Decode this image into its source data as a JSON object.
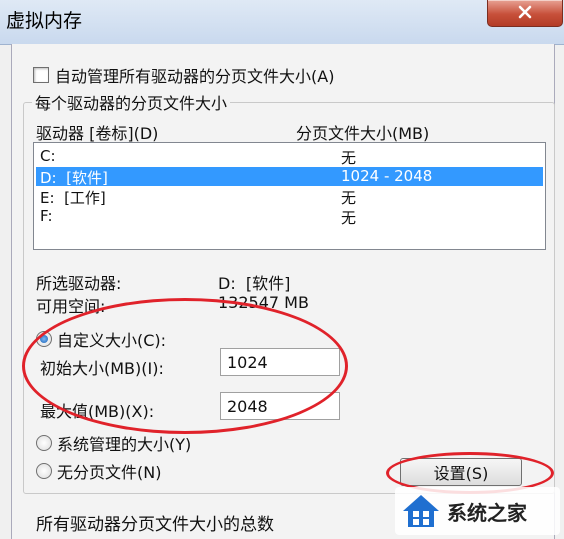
{
  "window": {
    "title": "虚拟内存"
  },
  "auto_manage": {
    "label": "自动管理所有驱动器的分页文件大小(A)",
    "checked": false
  },
  "group": {
    "legend": "每个驱动器的分页文件大小",
    "col_drive": "驱动器 [卷标](D)",
    "col_size": "分页文件大小(MB)"
  },
  "drives": [
    {
      "drive": "C:",
      "size": "无",
      "selected": false
    },
    {
      "drive": "D:  [软件]",
      "size": "1024 - 2048",
      "selected": true
    },
    {
      "drive": "E:  [工作]",
      "size": "无",
      "selected": false
    },
    {
      "drive": "F:",
      "size": "无",
      "selected": false
    }
  ],
  "selected_drive": {
    "label": "所选驱动器:",
    "value": "D:  [软件]"
  },
  "free_space": {
    "label": "可用空间:",
    "value": "132547 MB"
  },
  "custom_size": {
    "label": "自定义大小(C):",
    "checked": true
  },
  "initial_size": {
    "label": "初始大小(MB)(I):",
    "value": "1024"
  },
  "max_size": {
    "label": "最大值(MB)(X):",
    "value": "2048"
  },
  "system_managed": {
    "label": "系统管理的大小(Y)",
    "checked": false
  },
  "no_paging": {
    "label": "无分页文件(N)",
    "checked": false
  },
  "set_button": {
    "label": "设置(S)"
  },
  "total_section": {
    "label": "所有驱动器分页文件大小的总数"
  },
  "watermark": {
    "text": "系统之家"
  },
  "colors": {
    "annotation": "#e0222a",
    "selection": "#3399ff"
  }
}
